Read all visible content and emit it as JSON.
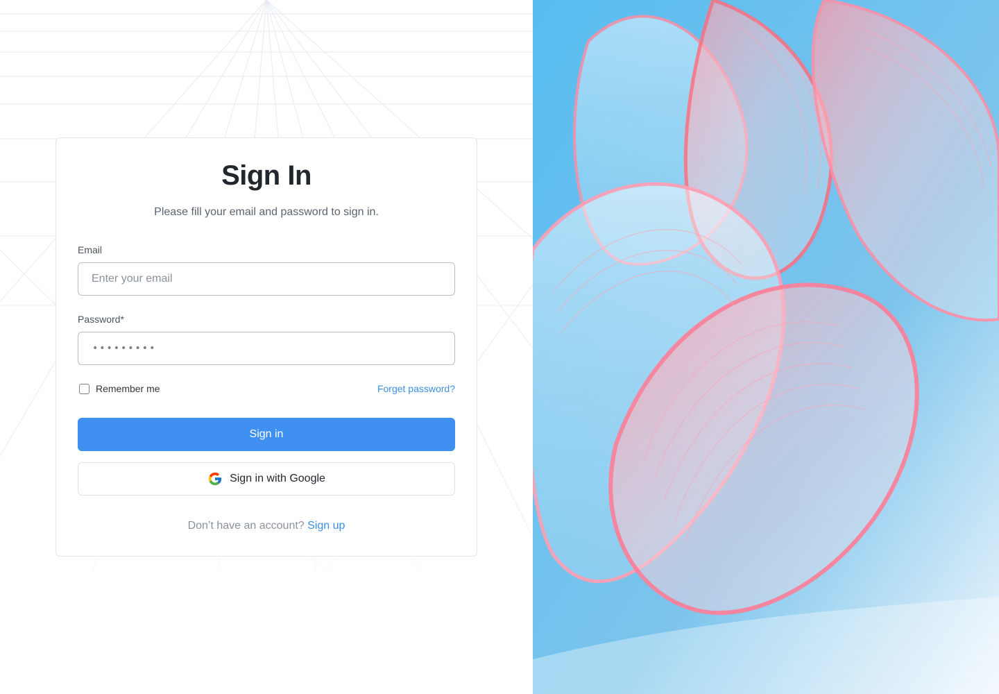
{
  "signin": {
    "title": "Sign In",
    "subtitle": "Please fill your email and password to sign in.",
    "email_label": "Email",
    "email_placeholder": "Enter your email",
    "email_value": "",
    "password_label": "Password*",
    "password_masked": "•••••••••",
    "remember_label": "Remember me",
    "remember_checked": false,
    "forget_label": "Forget password?",
    "signin_button": "Sign in",
    "google_button": "Sign in with Google",
    "footer_text": "Don’t have an account?",
    "signup_link": "Sign up"
  },
  "colors": {
    "primary": "#4090f2",
    "link": "#3b8fe0",
    "sky": "#5ab8ec"
  },
  "icons": {
    "google": "google-icon",
    "checkbox": "checkbox-icon"
  },
  "hero": {
    "image": "abstract-glass-ribbons"
  }
}
